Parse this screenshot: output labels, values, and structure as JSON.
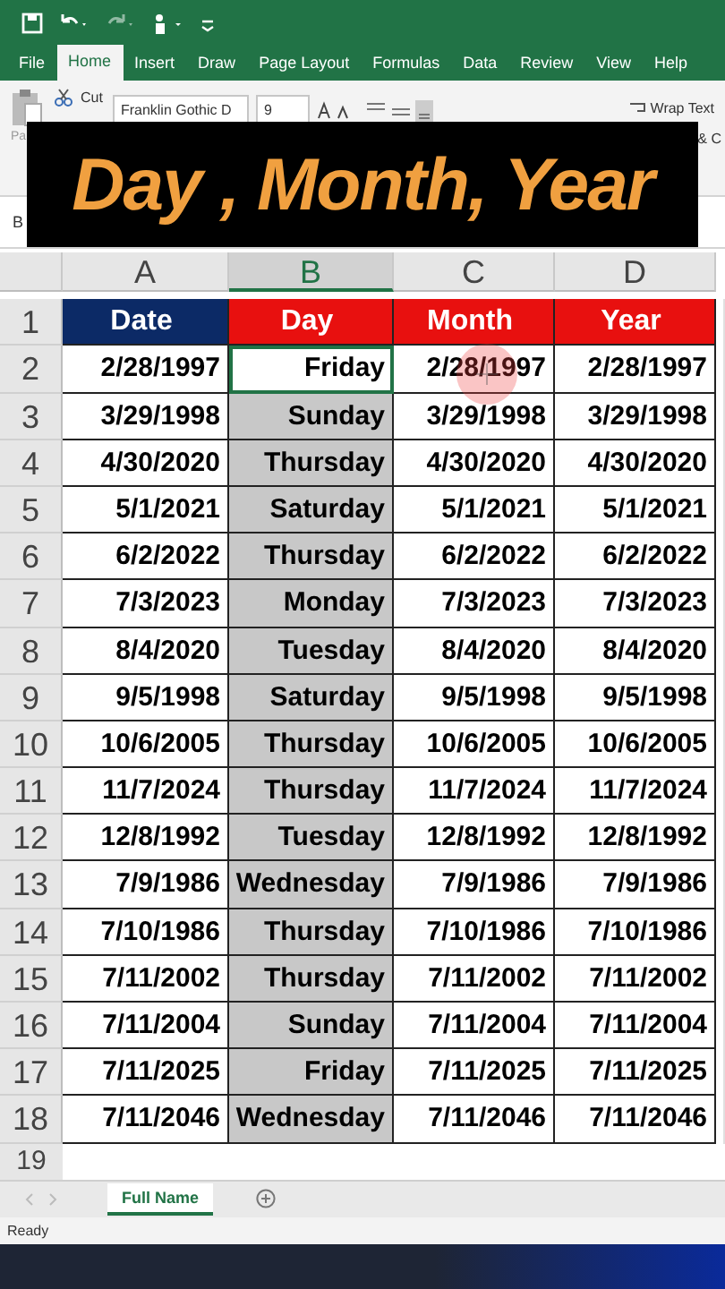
{
  "ribbon_tabs": [
    {
      "label": "File",
      "selected": false
    },
    {
      "label": "Home",
      "selected": true
    },
    {
      "label": "Insert",
      "selected": false
    },
    {
      "label": "Draw",
      "selected": false
    },
    {
      "label": "Page Layout",
      "selected": false
    },
    {
      "label": "Formulas",
      "selected": false
    },
    {
      "label": "Data",
      "selected": false
    },
    {
      "label": "Review",
      "selected": false
    },
    {
      "label": "View",
      "selected": false
    },
    {
      "label": "Help",
      "selected": false
    }
  ],
  "ribbon": {
    "cut": "Cut",
    "font": "Franklin Gothic D",
    "font_size": "9",
    "wrap_text": "Wrap Text",
    "merge": "& C",
    "paste": "Pa"
  },
  "name_box": "B",
  "banner": "Day , Month, Year",
  "columns": [
    {
      "label": "A",
      "selected": false
    },
    {
      "label": "B",
      "selected": true
    },
    {
      "label": "C",
      "selected": false
    },
    {
      "label": "D",
      "selected": false
    }
  ],
  "header_row": {
    "number": "1",
    "cells": [
      {
        "text": "Date",
        "color": "#0c2a66"
      },
      {
        "text": "Day",
        "color": "#e8100f"
      },
      {
        "text": "Month",
        "color": "#e8100f"
      },
      {
        "text": "Year",
        "color": "#e8100f"
      }
    ]
  },
  "rows": [
    {
      "number": "2",
      "active": true,
      "cells": [
        "2/28/1997",
        "Friday",
        "2/28/1997",
        "2/28/1997"
      ]
    },
    {
      "number": "3",
      "active": false,
      "cells": [
        "3/29/1998",
        "Sunday",
        "3/29/1998",
        "3/29/1998"
      ]
    },
    {
      "number": "4",
      "active": false,
      "cells": [
        "4/30/2020",
        "Thursday",
        "4/30/2020",
        "4/30/2020"
      ]
    },
    {
      "number": "5",
      "active": false,
      "cells": [
        "5/1/2021",
        "Saturday",
        "5/1/2021",
        "5/1/2021"
      ]
    },
    {
      "number": "6",
      "active": false,
      "cells": [
        "6/2/2022",
        "Thursday",
        "6/2/2022",
        "6/2/2022"
      ]
    },
    {
      "number": "7",
      "active": false,
      "cells": [
        "7/3/2023",
        "Monday",
        "7/3/2023",
        "7/3/2023"
      ]
    },
    {
      "number": "8",
      "active": false,
      "cells": [
        "8/4/2020",
        "Tuesday",
        "8/4/2020",
        "8/4/2020"
      ]
    },
    {
      "number": "9",
      "active": false,
      "cells": [
        "9/5/1998",
        "Saturday",
        "9/5/1998",
        "9/5/1998"
      ]
    },
    {
      "number": "10",
      "active": false,
      "cells": [
        "10/6/2005",
        "Thursday",
        "10/6/2005",
        "10/6/2005"
      ]
    },
    {
      "number": "11",
      "active": false,
      "cells": [
        "11/7/2024",
        "Thursday",
        "11/7/2024",
        "11/7/2024"
      ]
    },
    {
      "number": "12",
      "active": false,
      "cells": [
        "12/8/1992",
        "Tuesday",
        "12/8/1992",
        "12/8/1992"
      ]
    },
    {
      "number": "13",
      "active": false,
      "cells": [
        "7/9/1986",
        "Wednesday",
        "7/9/1986",
        "7/9/1986"
      ]
    },
    {
      "number": "14",
      "active": false,
      "cells": [
        "7/10/1986",
        "Thursday",
        "7/10/1986",
        "7/10/1986"
      ]
    },
    {
      "number": "15",
      "active": false,
      "cells": [
        "7/11/2002",
        "Thursday",
        "7/11/2002",
        "7/11/2002"
      ]
    },
    {
      "number": "16",
      "active": false,
      "cells": [
        "7/11/2004",
        "Sunday",
        "7/11/2004",
        "7/11/2004"
      ]
    },
    {
      "number": "17",
      "active": false,
      "cells": [
        "7/11/2025",
        "Friday",
        "7/11/2025",
        "7/11/2025"
      ]
    },
    {
      "number": "18",
      "active": false,
      "cells": [
        "7/11/2046",
        "Wednesday",
        "7/11/2046",
        "7/11/2046"
      ]
    }
  ],
  "partial_row": "19",
  "sheet_tabs": [
    {
      "label": "Full Name",
      "selected": true
    }
  ],
  "status": "Ready"
}
